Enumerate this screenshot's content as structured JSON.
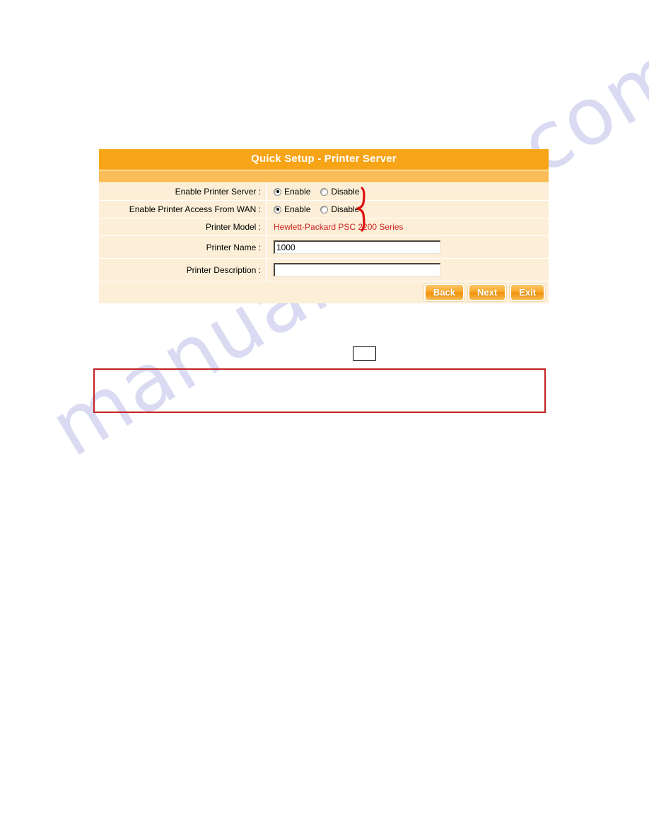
{
  "watermark": {
    "text": "manualshive.com",
    "color": "#d9d9f2"
  },
  "panel": {
    "title": "Quick Setup - Printer Server",
    "title_bar_color": "#f7a417",
    "sub_bar_color": "#fbbd58",
    "row_bg_color": "#fceed7",
    "rows": [
      {
        "label": "Enable Printer Server :",
        "type": "radio",
        "options": [
          {
            "label": "Enable",
            "checked": true
          },
          {
            "label": "Disable",
            "checked": false
          }
        ]
      },
      {
        "label": "Enable Printer Access From WAN :",
        "type": "radio",
        "options": [
          {
            "label": "Enable",
            "checked": true
          },
          {
            "label": "Disable",
            "checked": false
          }
        ]
      },
      {
        "label": "Printer Model :",
        "type": "text",
        "value": "Hewlett-Packard PSC 2200 Series",
        "color": "#cc2222"
      },
      {
        "label": "Printer Name :",
        "type": "input",
        "value": "1000",
        "placeholder": ""
      },
      {
        "label": "Printer Description :",
        "type": "input",
        "value": "",
        "placeholder": ""
      }
    ],
    "buttons": [
      {
        "label": "Back"
      },
      {
        "label": "Next"
      },
      {
        "label": "Exit"
      }
    ]
  },
  "annotations": {
    "brace_color": "#dd1111",
    "small_box_text": "",
    "red_box_text": "",
    "red_box_color": "#c32222"
  }
}
